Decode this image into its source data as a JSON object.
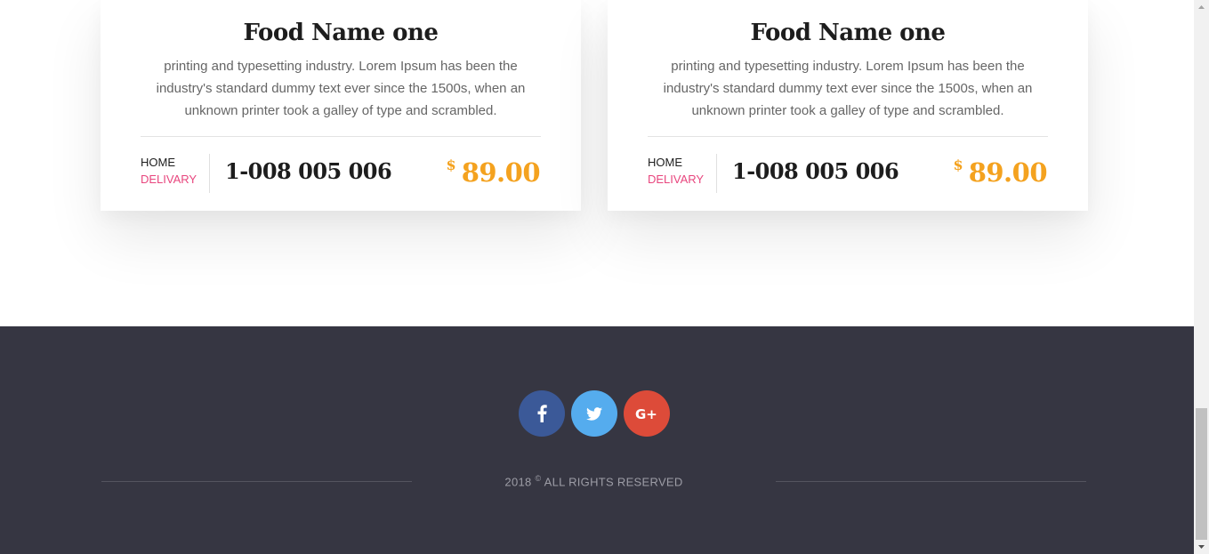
{
  "cards": [
    {
      "title": "Food Name one",
      "description": "printing and typesetting industry. Lorem Ipsum has been the industry's standard dummy text ever since the 1500s, when an unknown printer took a galley of type and scrambled.",
      "delivery_home": "HOME",
      "delivery_label": "DELIVARY",
      "phone": "1-008 005 006",
      "currency": "$",
      "price": "89.00"
    },
    {
      "title": "Food Name one",
      "description": "printing and typesetting industry. Lorem Ipsum has been the industry's standard dummy text ever since the 1500s, when an unknown printer took a galley of type and scrambled.",
      "delivery_home": "HOME",
      "delivery_label": "DELIVARY",
      "phone": "1-008 005 006",
      "currency": "$",
      "price": "89.00"
    }
  ],
  "footer": {
    "social": [
      {
        "icon": "facebook-icon",
        "color": "#3b5998"
      },
      {
        "icon": "twitter-icon",
        "color": "#55acee"
      },
      {
        "icon": "google-plus-icon",
        "color": "#dd4b39"
      }
    ],
    "copyright_year": "2018",
    "copyright_symbol": "©",
    "copyright_text": "ALL RIGHTS RESERVED",
    "background": "#363642"
  },
  "colors": {
    "accent_price": "#f4a21f",
    "accent_delivery": "#e8467e",
    "heading": "#1d1d1d"
  }
}
